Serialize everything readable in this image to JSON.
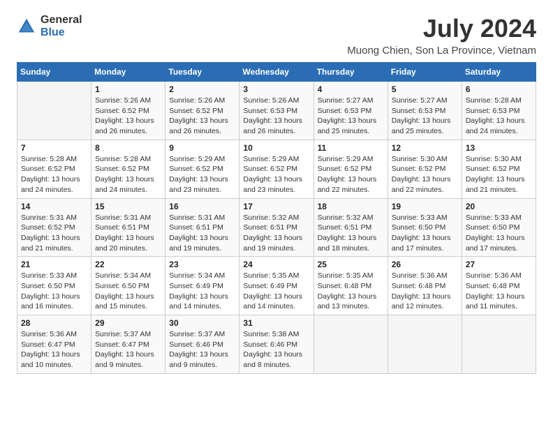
{
  "header": {
    "logo_general": "General",
    "logo_blue": "Blue",
    "month_title": "July 2024",
    "location": "Muong Chien, Son La Province, Vietnam"
  },
  "weekdays": [
    "Sunday",
    "Monday",
    "Tuesday",
    "Wednesday",
    "Thursday",
    "Friday",
    "Saturday"
  ],
  "weeks": [
    [
      {
        "day": "",
        "detail": ""
      },
      {
        "day": "1",
        "detail": "Sunrise: 5:26 AM\nSunset: 6:52 PM\nDaylight: 13 hours\nand 26 minutes."
      },
      {
        "day": "2",
        "detail": "Sunrise: 5:26 AM\nSunset: 6:52 PM\nDaylight: 13 hours\nand 26 minutes."
      },
      {
        "day": "3",
        "detail": "Sunrise: 5:26 AM\nSunset: 6:53 PM\nDaylight: 13 hours\nand 26 minutes."
      },
      {
        "day": "4",
        "detail": "Sunrise: 5:27 AM\nSunset: 6:53 PM\nDaylight: 13 hours\nand 25 minutes."
      },
      {
        "day": "5",
        "detail": "Sunrise: 5:27 AM\nSunset: 6:53 PM\nDaylight: 13 hours\nand 25 minutes."
      },
      {
        "day": "6",
        "detail": "Sunrise: 5:28 AM\nSunset: 6:53 PM\nDaylight: 13 hours\nand 24 minutes."
      }
    ],
    [
      {
        "day": "7",
        "detail": "Sunrise: 5:28 AM\nSunset: 6:52 PM\nDaylight: 13 hours\nand 24 minutes."
      },
      {
        "day": "8",
        "detail": "Sunrise: 5:28 AM\nSunset: 6:52 PM\nDaylight: 13 hours\nand 24 minutes."
      },
      {
        "day": "9",
        "detail": "Sunrise: 5:29 AM\nSunset: 6:52 PM\nDaylight: 13 hours\nand 23 minutes."
      },
      {
        "day": "10",
        "detail": "Sunrise: 5:29 AM\nSunset: 6:52 PM\nDaylight: 13 hours\nand 23 minutes."
      },
      {
        "day": "11",
        "detail": "Sunrise: 5:29 AM\nSunset: 6:52 PM\nDaylight: 13 hours\nand 22 minutes."
      },
      {
        "day": "12",
        "detail": "Sunrise: 5:30 AM\nSunset: 6:52 PM\nDaylight: 13 hours\nand 22 minutes."
      },
      {
        "day": "13",
        "detail": "Sunrise: 5:30 AM\nSunset: 6:52 PM\nDaylight: 13 hours\nand 21 minutes."
      }
    ],
    [
      {
        "day": "14",
        "detail": "Sunrise: 5:31 AM\nSunset: 6:52 PM\nDaylight: 13 hours\nand 21 minutes."
      },
      {
        "day": "15",
        "detail": "Sunrise: 5:31 AM\nSunset: 6:51 PM\nDaylight: 13 hours\nand 20 minutes."
      },
      {
        "day": "16",
        "detail": "Sunrise: 5:31 AM\nSunset: 6:51 PM\nDaylight: 13 hours\nand 19 minutes."
      },
      {
        "day": "17",
        "detail": "Sunrise: 5:32 AM\nSunset: 6:51 PM\nDaylight: 13 hours\nand 19 minutes."
      },
      {
        "day": "18",
        "detail": "Sunrise: 5:32 AM\nSunset: 6:51 PM\nDaylight: 13 hours\nand 18 minutes."
      },
      {
        "day": "19",
        "detail": "Sunrise: 5:33 AM\nSunset: 6:50 PM\nDaylight: 13 hours\nand 17 minutes."
      },
      {
        "day": "20",
        "detail": "Sunrise: 5:33 AM\nSunset: 6:50 PM\nDaylight: 13 hours\nand 17 minutes."
      }
    ],
    [
      {
        "day": "21",
        "detail": "Sunrise: 5:33 AM\nSunset: 6:50 PM\nDaylight: 13 hours\nand 16 minutes."
      },
      {
        "day": "22",
        "detail": "Sunrise: 5:34 AM\nSunset: 6:50 PM\nDaylight: 13 hours\nand 15 minutes."
      },
      {
        "day": "23",
        "detail": "Sunrise: 5:34 AM\nSunset: 6:49 PM\nDaylight: 13 hours\nand 14 minutes."
      },
      {
        "day": "24",
        "detail": "Sunrise: 5:35 AM\nSunset: 6:49 PM\nDaylight: 13 hours\nand 14 minutes."
      },
      {
        "day": "25",
        "detail": "Sunrise: 5:35 AM\nSunset: 6:48 PM\nDaylight: 13 hours\nand 13 minutes."
      },
      {
        "day": "26",
        "detail": "Sunrise: 5:36 AM\nSunset: 6:48 PM\nDaylight: 13 hours\nand 12 minutes."
      },
      {
        "day": "27",
        "detail": "Sunrise: 5:36 AM\nSunset: 6:48 PM\nDaylight: 13 hours\nand 11 minutes."
      }
    ],
    [
      {
        "day": "28",
        "detail": "Sunrise: 5:36 AM\nSunset: 6:47 PM\nDaylight: 13 hours\nand 10 minutes."
      },
      {
        "day": "29",
        "detail": "Sunrise: 5:37 AM\nSunset: 6:47 PM\nDaylight: 13 hours\nand 9 minutes."
      },
      {
        "day": "30",
        "detail": "Sunrise: 5:37 AM\nSunset: 6:46 PM\nDaylight: 13 hours\nand 9 minutes."
      },
      {
        "day": "31",
        "detail": "Sunrise: 5:38 AM\nSunset: 6:46 PM\nDaylight: 13 hours\nand 8 minutes."
      },
      {
        "day": "",
        "detail": ""
      },
      {
        "day": "",
        "detail": ""
      },
      {
        "day": "",
        "detail": ""
      }
    ]
  ]
}
